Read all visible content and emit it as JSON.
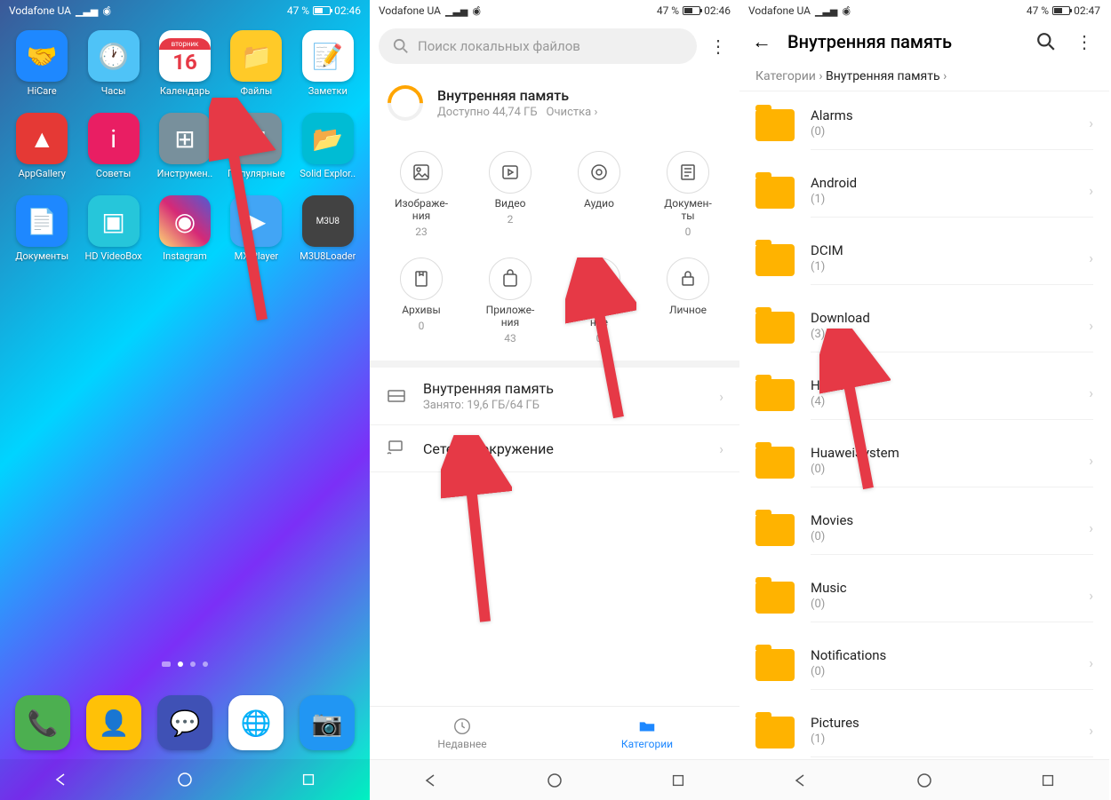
{
  "statusbar": {
    "carrier": "Vodafone UA",
    "battery_pct": "47 %",
    "time1": "02:46",
    "time2": "02:46",
    "time3": "02:47"
  },
  "colors": {
    "arrow": "#e63946",
    "accent_blue": "#1e88ff",
    "folder": "#ffb300"
  },
  "home": {
    "calendar_day": "вторник",
    "calendar_num": "16",
    "apps": [
      {
        "label": "HiCare",
        "bg": "#1e88ff",
        "glyph": "🤝"
      },
      {
        "label": "Часы",
        "bg": "#4fc3f7",
        "glyph": "🕐"
      },
      {
        "label": "Календарь",
        "bg": "#fff",
        "glyph": ""
      },
      {
        "label": "Файлы",
        "bg": "#ffca28",
        "glyph": "📁"
      },
      {
        "label": "Заметки",
        "bg": "#fff",
        "glyph": "📝"
      },
      {
        "label": "AppGallery",
        "bg": "#e53935",
        "glyph": "▲"
      },
      {
        "label": "Советы",
        "bg": "#e91e63",
        "glyph": "i"
      },
      {
        "label": "Инструмен..",
        "bg": "#78909c",
        "glyph": "⊞"
      },
      {
        "label": "Популярные",
        "bg": "#78909c",
        "glyph": "⊞"
      },
      {
        "label": "Solid Explor..",
        "bg": "#00bcd4",
        "glyph": "📂"
      },
      {
        "label": "Документы",
        "bg": "#1e88ff",
        "glyph": "📄"
      },
      {
        "label": "HD VideoBox",
        "bg": "#26c6da",
        "glyph": "▣"
      },
      {
        "label": "Instagram",
        "bg": "linear-gradient(45deg,#feda75,#d62976,#4f5bd5)",
        "glyph": "◉"
      },
      {
        "label": "MX Player",
        "bg": "#42a5f5",
        "glyph": "▶"
      },
      {
        "label": "M3U8Loader",
        "bg": "#424242",
        "glyph": "M3U8"
      }
    ],
    "dock": [
      {
        "bg": "#4caf50",
        "glyph": "📞"
      },
      {
        "bg": "#ffc107",
        "glyph": "👤"
      },
      {
        "bg": "#3f51b5",
        "glyph": "💬"
      },
      {
        "bg": "#fff",
        "glyph": "🌐"
      },
      {
        "bg": "#2196f3",
        "glyph": "📷"
      }
    ]
  },
  "files": {
    "search_placeholder": "Поиск локальных файлов",
    "storage_title": "Внутренняя память",
    "storage_sub": "Доступно 44,74 ГБ",
    "cleanup": "Очистка",
    "categories": [
      {
        "label": "Изображе-\nния",
        "count": "23"
      },
      {
        "label": "Видео",
        "count": "2"
      },
      {
        "label": "Аудио",
        "count": ""
      },
      {
        "label": "Докумен-\nты",
        "count": "0"
      },
      {
        "label": "Архивы",
        "count": "0"
      },
      {
        "label": "Приложе-\nния",
        "count": "43"
      },
      {
        "label": "Избран-\nное",
        "count": "0"
      },
      {
        "label": "Личное",
        "count": ""
      }
    ],
    "internal_title": "Внутренняя память",
    "internal_sub": "Занято: 19,6 ГБ/64 ГБ",
    "network": "Сетевое окружение",
    "tab_recent": "Недавнее",
    "tab_categories": "Категории"
  },
  "browser": {
    "title": "Внутренняя память",
    "bc_root": "Категории",
    "bc_current": "Внутренняя память",
    "folders": [
      {
        "name": "Alarms",
        "count": "(0)"
      },
      {
        "name": "Android",
        "count": "(1)"
      },
      {
        "name": "DCIM",
        "count": "(1)"
      },
      {
        "name": "Download",
        "count": "(3)"
      },
      {
        "name": "Huawei",
        "count": "(4)"
      },
      {
        "name": "HuaweiSystem",
        "count": "(0)"
      },
      {
        "name": "Movies",
        "count": "(0)"
      },
      {
        "name": "Music",
        "count": "(0)"
      },
      {
        "name": "Notifications",
        "count": "(0)"
      },
      {
        "name": "Pictures",
        "count": "(1)"
      }
    ]
  }
}
